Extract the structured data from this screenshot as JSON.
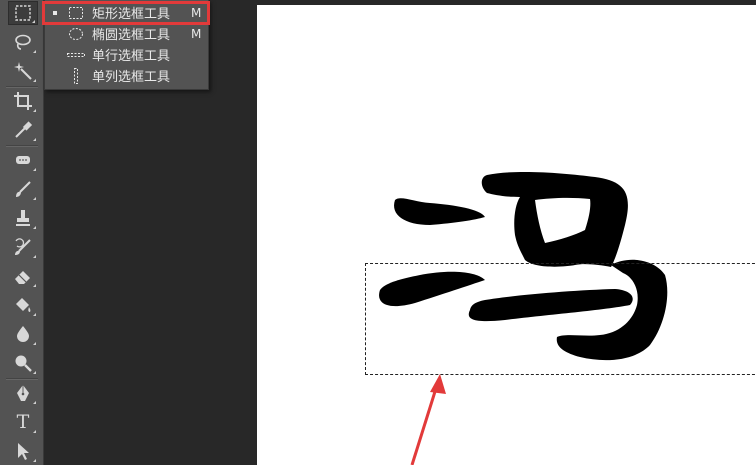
{
  "tool_flyout": {
    "items": [
      {
        "label": "矩形选框工具",
        "shortcut": "M",
        "selected": true,
        "icon": "rectangular-marquee-icon"
      },
      {
        "label": "椭圆选框工具",
        "shortcut": "M",
        "selected": false,
        "icon": "elliptical-marquee-icon"
      },
      {
        "label": "单行选框工具",
        "shortcut": "",
        "selected": false,
        "icon": "single-row-marquee-icon"
      },
      {
        "label": "单列选框工具",
        "shortcut": "",
        "selected": false,
        "icon": "single-column-marquee-icon"
      }
    ],
    "highlight_color": "#e23a3a"
  },
  "toolbar": {
    "tools": [
      "rectangular-marquee-icon",
      "lasso-icon",
      "magic-wand-icon",
      "crop-icon",
      "eyedropper-icon",
      "healing-brush-icon",
      "brush-icon",
      "clone-stamp-icon",
      "history-brush-icon",
      "eraser-icon",
      "paint-bucket-icon",
      "blur-icon",
      "dodge-icon",
      "pen-icon",
      "type-icon",
      "path-selection-icon"
    ],
    "type_tool_glyph": "T"
  },
  "canvas": {
    "character": "冯",
    "background_color": "#ffffff",
    "annotation_arrow_color": "#e23a3a"
  }
}
